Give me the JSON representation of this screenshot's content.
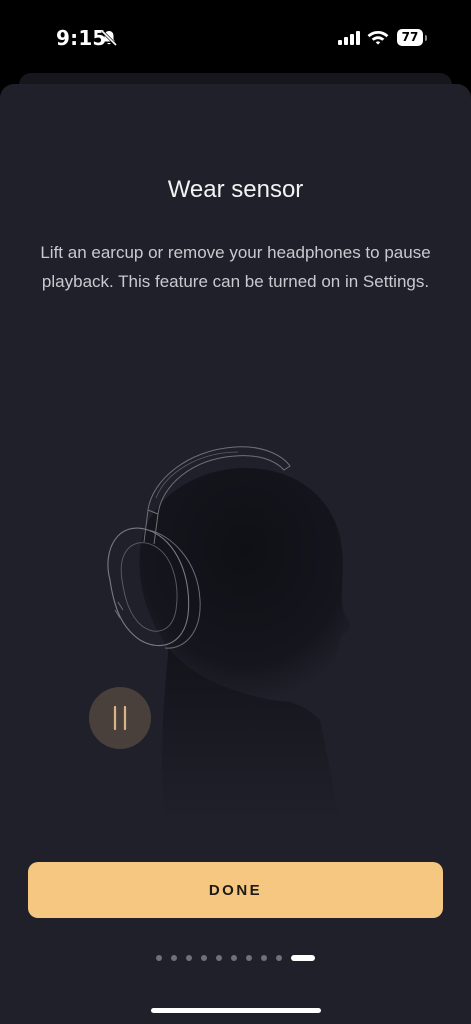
{
  "status_bar": {
    "time": "9:15",
    "battery": "77",
    "icons": [
      "bell-muted-icon",
      "cellular-signal-icon",
      "wifi-icon",
      "battery-icon"
    ]
  },
  "content": {
    "title": "Wear sensor",
    "description": "Lift an earcup or remove your headphones to pause playback. This feature can be turned on in Settings."
  },
  "illustration": {
    "subject": "head-with-headphones",
    "icon": "pause-icon"
  },
  "actions": {
    "done_label": "DONE"
  },
  "pager": {
    "total_pages": 10,
    "current_page": 10
  },
  "colors": {
    "background": "#1f2029",
    "accent": "#f6c781",
    "pause_badge": "#4a403b"
  }
}
